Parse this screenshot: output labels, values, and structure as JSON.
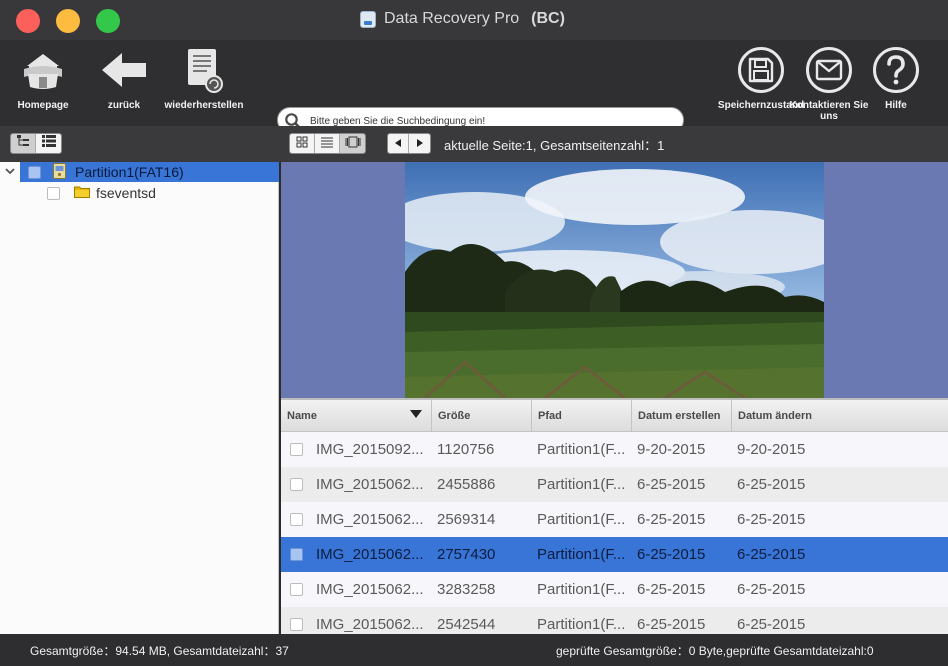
{
  "window": {
    "title": "Data Recovery Pro",
    "title_suffix": "(BC)"
  },
  "toolbar": {
    "homepage_label": "Homepage",
    "back_label": "zurück",
    "restore_label": "wiederherstellen",
    "save_state_label": "Speichernzustand",
    "contact_label": "Kontaktieren Sie uns",
    "help_label": "Hilfe"
  },
  "search": {
    "placeholder": "Bitte geben Sie die Suchbedingung ein!"
  },
  "pager": {
    "text": "aktuelle Seite:1,  Gesamtseitenzahl：1"
  },
  "tree": {
    "items": [
      {
        "label": "Partition1(FAT16)",
        "selected": true
      },
      {
        "label": "fseventsd",
        "selected": false
      }
    ]
  },
  "table": {
    "columns": [
      "Name",
      "Größe",
      "Pfad",
      "Datum erstellen",
      "Datum ändern"
    ],
    "rows": [
      {
        "name": "IMG_2015092...",
        "size": "1120756",
        "path": "Partition1(F...",
        "created": "9-20-2015",
        "modified": "9-20-2015"
      },
      {
        "name": "IMG_2015062...",
        "size": "2455886",
        "path": "Partition1(F...",
        "created": "6-25-2015",
        "modified": "6-25-2015"
      },
      {
        "name": "IMG_2015062...",
        "size": "2569314",
        "path": "Partition1(F...",
        "created": "6-25-2015",
        "modified": "6-25-2015"
      },
      {
        "name": "IMG_2015062...",
        "size": "2757430",
        "path": "Partition1(F...",
        "created": "6-25-2015",
        "modified": "6-25-2015"
      },
      {
        "name": "IMG_2015062...",
        "size": "3283258",
        "path": "Partition1(F...",
        "created": "6-25-2015",
        "modified": "6-25-2015"
      },
      {
        "name": "IMG_2015062...",
        "size": "2542544",
        "path": "Partition1(F...",
        "created": "6-25-2015",
        "modified": "6-25-2015"
      }
    ],
    "selected_row": 3
  },
  "status": {
    "left": "Gesamtgröße：94.54 MB,  Gesamtdateizahl：37",
    "right": "geprüfte Gesamtgröße：0 Byte,geprüfte Gesamtdateizahl:0"
  },
  "colors": {
    "selection": "#3875d7",
    "preview_background": "#6b79b3"
  }
}
